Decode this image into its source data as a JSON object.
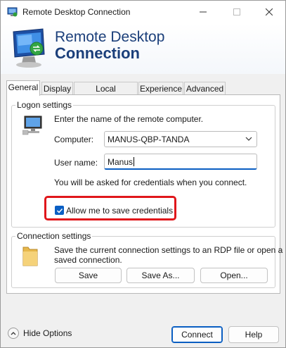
{
  "window": {
    "title": "Remote Desktop Connection",
    "banner_line1": "Remote Desktop",
    "banner_line2": "Connection"
  },
  "tabs": [
    {
      "label": "General",
      "active": true
    },
    {
      "label": "Display",
      "active": false
    },
    {
      "label": "Local Resources",
      "active": false
    },
    {
      "label": "Experience",
      "active": false
    },
    {
      "label": "Advanced",
      "active": false
    }
  ],
  "logon": {
    "group_label": "Logon settings",
    "instruction": "Enter the name of the remote computer.",
    "computer_label": "Computer:",
    "computer_value": "MANUS-QBP-TANDA",
    "username_label": "User name:",
    "username_value": "Manus",
    "credentials_note": "You will be asked for credentials when you connect.",
    "allow_save_label": "Allow me to save credentials",
    "allow_save_checked": true
  },
  "connection": {
    "group_label": "Connection settings",
    "description_line1": "Save the current connection settings to an RDP file or open a",
    "description_line2": "saved connection.",
    "save_label": "Save",
    "save_as_label": "Save As...",
    "open_label": "Open..."
  },
  "footer": {
    "hide_options_label": "Hide Options",
    "connect_label": "Connect",
    "help_label": "Help"
  },
  "colors": {
    "accent": "#0a5fc4",
    "banner_text": "#1b3f7a",
    "highlight": "#e0161b"
  }
}
